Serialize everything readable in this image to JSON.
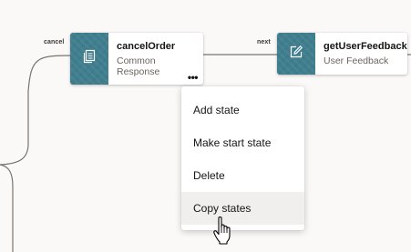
{
  "edges": {
    "cancel_label": "cancel",
    "next_label": "next"
  },
  "nodes": {
    "cancel_order": {
      "title": "cancelOrder",
      "subtitle_line1": "Common",
      "subtitle_line2": "Response",
      "icon": "document-stack-icon",
      "more": "•••"
    },
    "get_user_feedback": {
      "title": "getUserFeedback",
      "subtitle": "User Feedback",
      "icon": "edit-icon"
    }
  },
  "context_menu": {
    "items": [
      {
        "label": "Add state"
      },
      {
        "label": "Make start state"
      },
      {
        "label": "Delete"
      },
      {
        "label": "Copy states",
        "hovered": true
      }
    ]
  },
  "colors": {
    "canvas": "#fbf9f8",
    "node_icon_bg": "#3f7e8e",
    "edge": "#7a736d",
    "menu_hover": "#f1efed"
  },
  "cursor": "hand-pointer-icon"
}
